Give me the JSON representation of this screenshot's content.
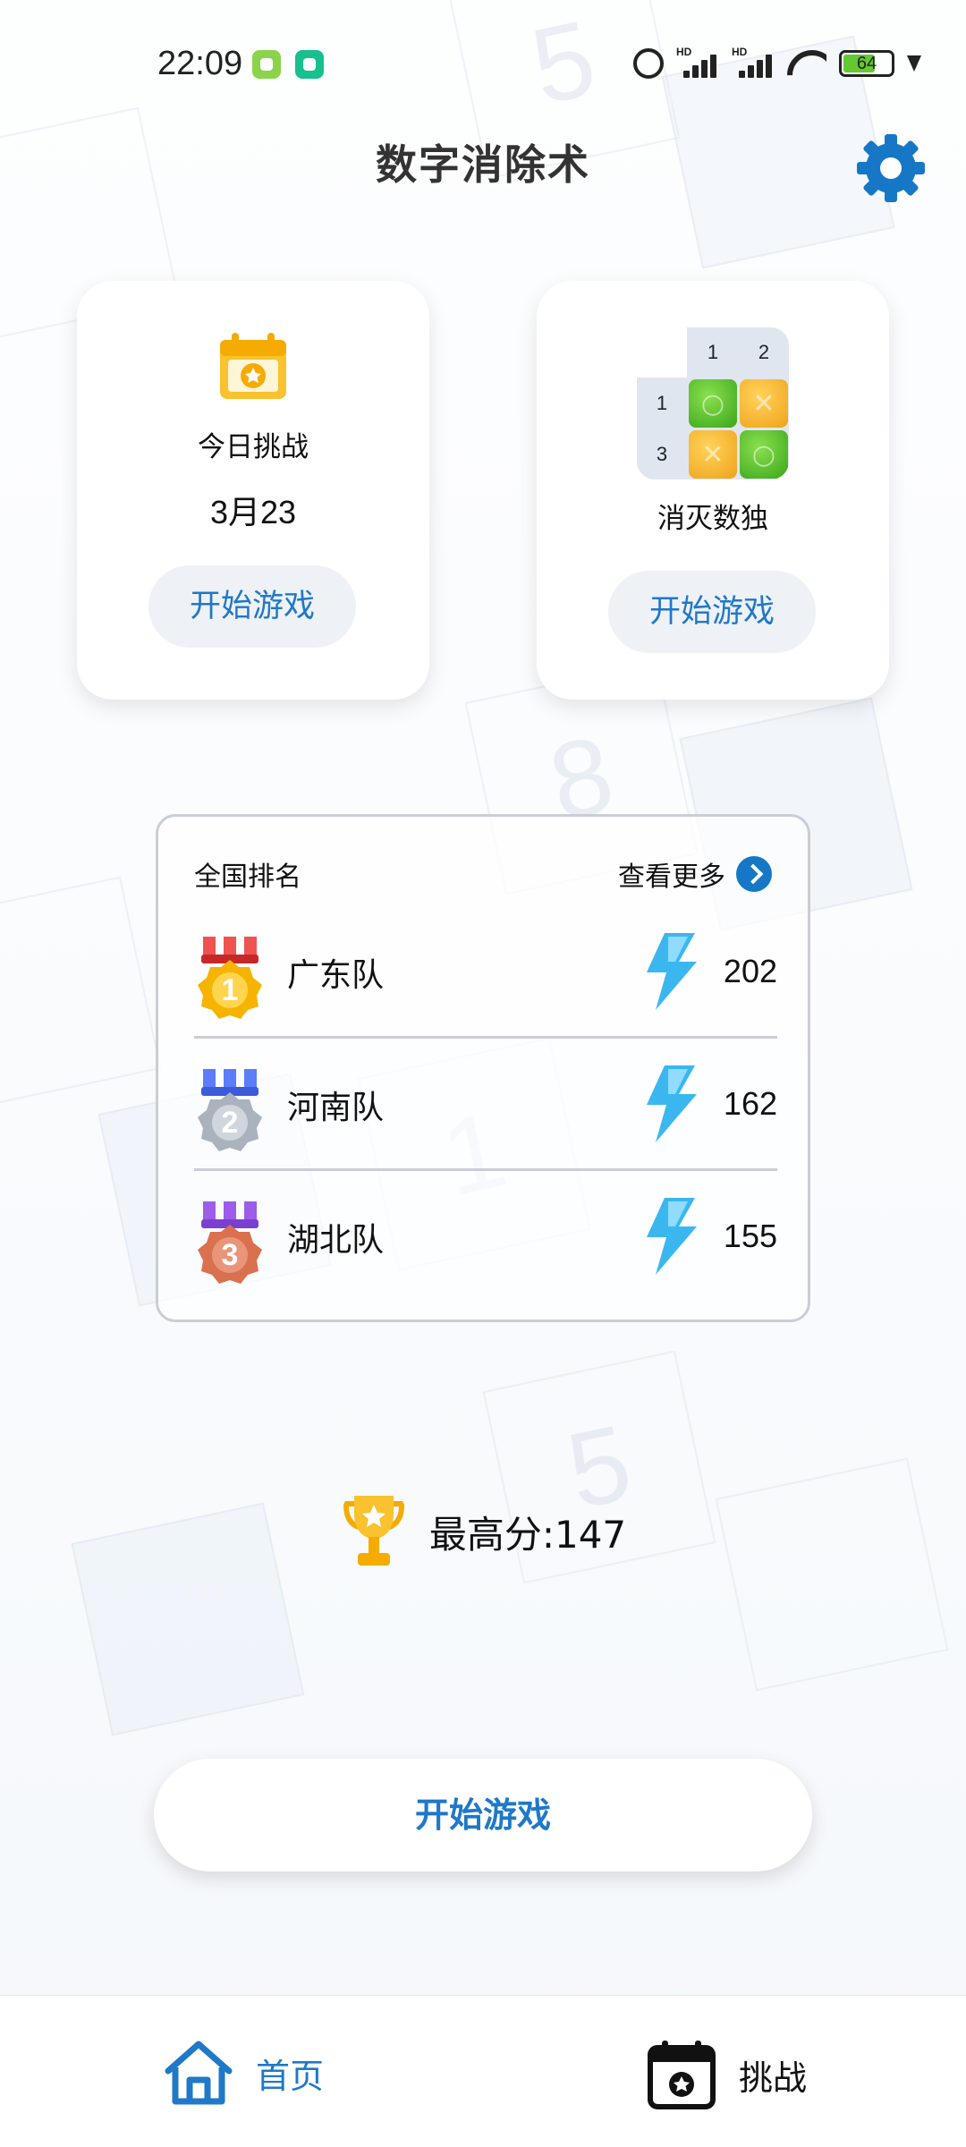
{
  "status_bar": {
    "time": "22:09",
    "signal1_label": "HD",
    "signal2_label": "HD",
    "battery": "64"
  },
  "header": {
    "title": "数字消除术"
  },
  "modes": {
    "daily": {
      "label": "今日挑战",
      "date": "3月23",
      "button": "开始游戏"
    },
    "sudoku": {
      "label": "消灭数独",
      "button": "开始游戏",
      "grid_col_hints": [
        "1",
        "2"
      ],
      "grid_row_hints": [
        "1",
        "3"
      ]
    }
  },
  "ranking": {
    "title": "全国排名",
    "view_more": "查看更多",
    "rows": [
      {
        "rank": "1",
        "team": "广东队",
        "score": "202",
        "medal_color": "#f6b400"
      },
      {
        "rank": "2",
        "team": "河南队",
        "score": "162",
        "medal_color": "#a9b2bd"
      },
      {
        "rank": "3",
        "team": "湖北队",
        "score": "155",
        "medal_color": "#d9714f"
      }
    ]
  },
  "best_score": {
    "text": "最高分:147"
  },
  "start_button": {
    "label": "开始游戏"
  },
  "bottom_nav": {
    "home": "首页",
    "challenge": "挑战"
  },
  "colors": {
    "accent": "#1f78c8",
    "gold": "#f6b400",
    "bolt": "#3bb7f0"
  }
}
